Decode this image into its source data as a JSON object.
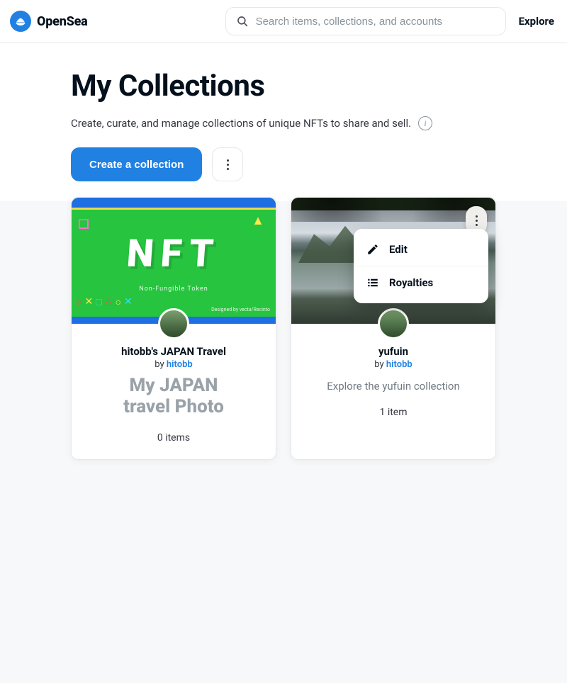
{
  "header": {
    "brand": "OpenSea",
    "search_placeholder": "Search items, collections, and accounts",
    "explore": "Explore"
  },
  "page": {
    "title": "My Collections",
    "subtitle": "Create, curate, and manage collections of unique NFTs to share and sell.",
    "create_label": "Create a collection"
  },
  "banner1": {
    "big": "NFT",
    "sub": "Non-Fungible Token",
    "credit": "Designed by vecta/Recinto"
  },
  "cards": [
    {
      "title": "hitobb's JAPAN Travel",
      "by_prefix": "by ",
      "author": "hitobb",
      "desc_big_line1": "My JAPAN",
      "desc_big_line2": "travel Photo",
      "count": "0 items"
    },
    {
      "title": "yufuin",
      "by_prefix": "by ",
      "author": "hitobb",
      "desc": "Explore the yufuin collection",
      "count": "1 item"
    }
  ],
  "menu": {
    "edit": "Edit",
    "royalties": "Royalties"
  }
}
